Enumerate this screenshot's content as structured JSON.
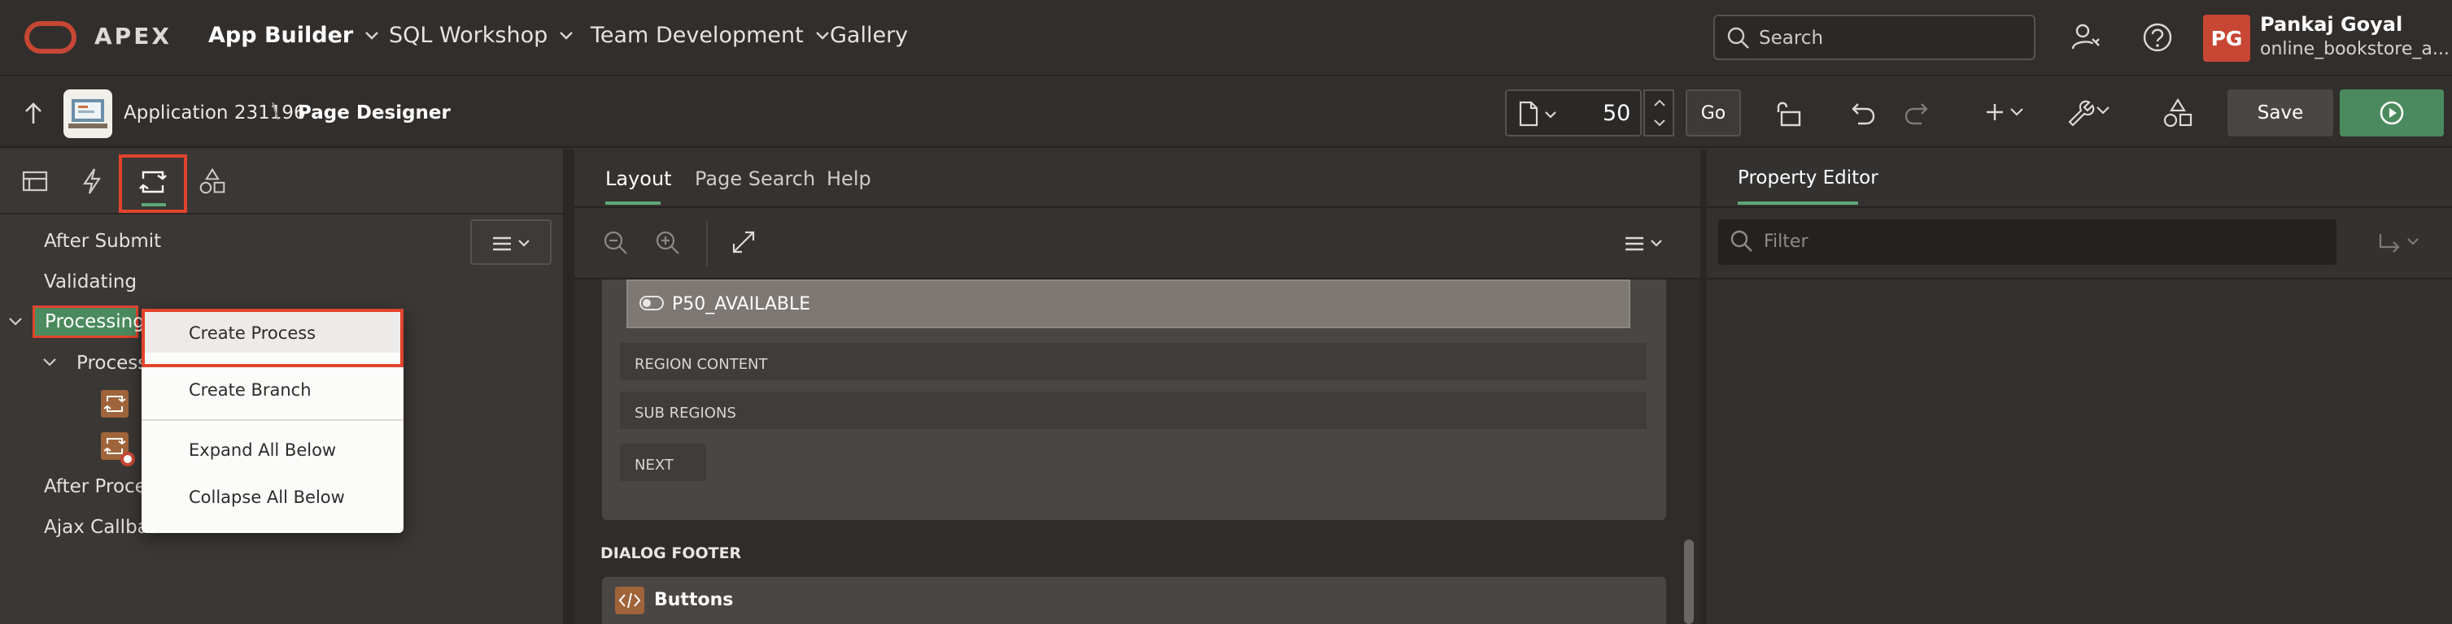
{
  "header": {
    "brand": "APEX",
    "nav": [
      "App Builder",
      "SQL Workshop",
      "Team Development",
      "Gallery"
    ],
    "search_placeholder": "Search",
    "user_initials": "PG",
    "user_name": "Pankaj Goyal",
    "workspace": "online_bookstore_a..."
  },
  "toolbar": {
    "application": "Application 231196",
    "separator": "\\",
    "page_designer": "Page Designer",
    "page_number": "50",
    "go_label": "Go",
    "save_label": "Save"
  },
  "left": {
    "tree": {
      "after_submit": "After Submit",
      "validating": "Validating",
      "processing": "Processing",
      "processes": "Processes",
      "after_processing": "After Proces",
      "ajax_callback": "Ajax Callbac"
    }
  },
  "context_menu": {
    "items": [
      "Create Process",
      "Create Branch",
      "Expand All Below",
      "Collapse All Below"
    ]
  },
  "center": {
    "tabs": [
      "Layout",
      "Page Search",
      "Help"
    ],
    "item_name": "P50_AVAILABLE",
    "regions": [
      "REGION CONTENT",
      "SUB REGIONS",
      "NEXT"
    ],
    "dialog_footer": "DIALOG FOOTER",
    "buttons_region": "Buttons"
  },
  "right": {
    "title": "Property Editor",
    "filter_placeholder": "Filter"
  },
  "colors": {
    "accent_green": "#4a8a5e",
    "highlight_red": "#e0442d",
    "avatar_red": "#c74634",
    "region_orange": "#a0643a"
  }
}
